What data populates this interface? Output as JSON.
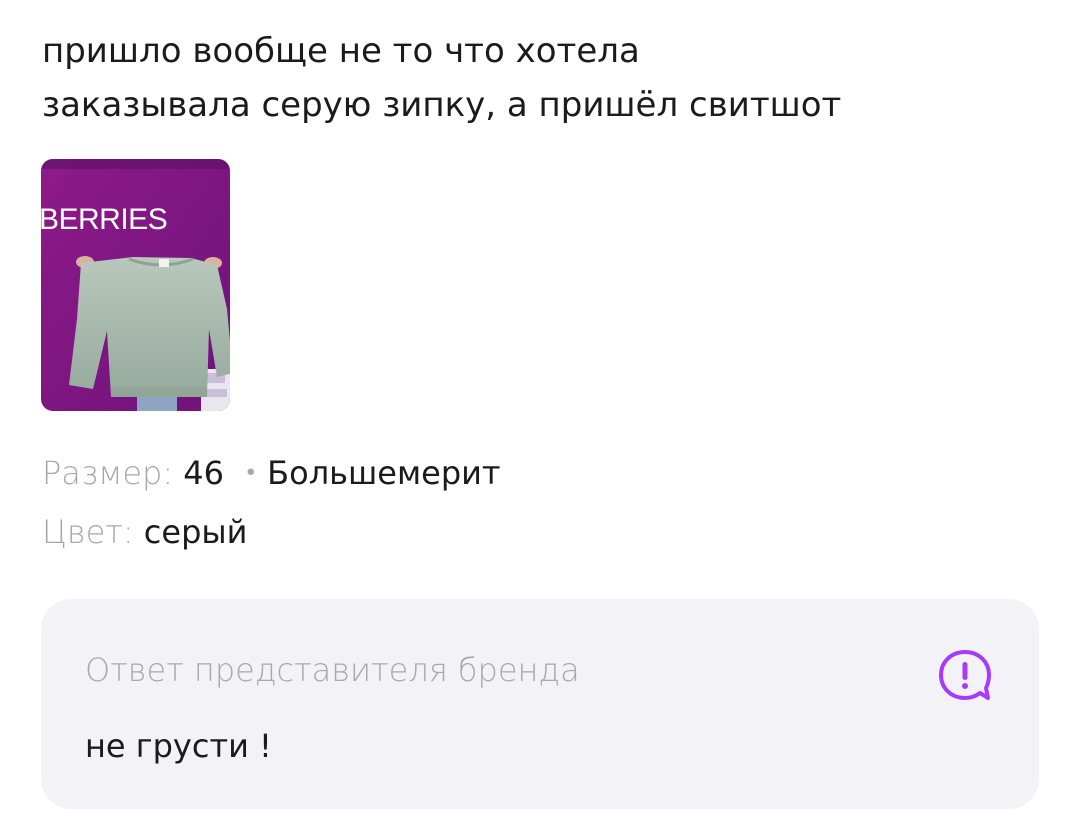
{
  "review": {
    "lines": [
      "пришло вообще не то что хотела",
      "заказывала серую зипку, а пришёл свитшот"
    ],
    "photo": {
      "logo_text": "BERRIES",
      "icon": "product-photo"
    }
  },
  "params": {
    "size_label": "Размер:",
    "size_value": "46",
    "separator": "•",
    "fit_value": "Большемерит",
    "color_label": "Цвет:",
    "color_value": "серый"
  },
  "brand_answer": {
    "title": "Ответ представителя бренда",
    "text": "не грусти !",
    "icon": "exclamation-bubble-icon",
    "accent_color": "#a73afd"
  }
}
